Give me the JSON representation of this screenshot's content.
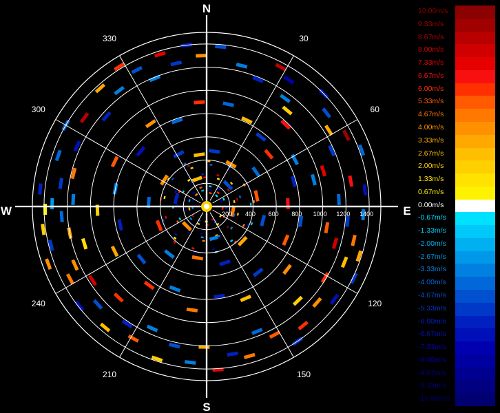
{
  "chart_data": {
    "type": "polar-radar-ppi",
    "compass": {
      "north": "N",
      "east": "E",
      "south": "S",
      "west": "W"
    },
    "azimuth_labels": [
      "30",
      "60",
      "120",
      "150",
      "210",
      "240",
      "300",
      "330"
    ],
    "range_labels": [
      "200",
      "400",
      "600",
      "800",
      "1000",
      "1200",
      "1400"
    ],
    "range_max": 1500,
    "colorbar": {
      "labels": [
        "10.00m/s",
        "9.33m/s",
        "8.67m/s",
        "8.00m/s",
        "7.33m/s",
        "6.67m/s",
        "6.00m/s",
        "5.33m/s",
        "4.67m/s",
        "4.00m/s",
        "3.33m/s",
        "2.67m/s",
        "2.00m/s",
        "1.33m/s",
        "0.67m/s",
        "0.00m/s",
        "-0.67m/s",
        "-1.33m/s",
        "-2.00m/s",
        "-2.67m/s",
        "-3.33m/s",
        "-4.00m/s",
        "-4.67m/s",
        "-5.33m/s",
        "-6.00m/s",
        "-6.67m/s",
        "-7.33m/s",
        "-8.00m/s",
        "-8.67m/s",
        "-9.33m/s",
        "-10.00m/s"
      ],
      "colors": [
        "#8b0000",
        "#a00000",
        "#b80000",
        "#d00000",
        "#e60000",
        "#f81010",
        "#ff3000",
        "#ff5a00",
        "#ff7800",
        "#ff9000",
        "#ffa800",
        "#ffbe00",
        "#ffd000",
        "#ffe200",
        "#fff200",
        "#ffffff",
        "#00e0ff",
        "#00c8f8",
        "#00b0f0",
        "#0098e8",
        "#0080e0",
        "#0068d8",
        "#0050d0",
        "#0038c8",
        "#0020c0",
        "#0010b8",
        "#0000b0",
        "#0000a0",
        "#000090",
        "#000080",
        "#000070"
      ]
    },
    "gates": [
      {
        "az": 5,
        "r": 1380,
        "v": -4.5
      },
      {
        "az": 14,
        "r": 1250,
        "v": -3.2
      },
      {
        "az": 22,
        "r": 1180,
        "v": -6.1
      },
      {
        "az": 28,
        "r": 1360,
        "v": 8.7
      },
      {
        "az": 33,
        "r": 1300,
        "v": -7.4
      },
      {
        "az": 36,
        "r": 1150,
        "v": -3.0
      },
      {
        "az": 40,
        "r": 1080,
        "v": 2.2
      },
      {
        "az": 44,
        "r": 980,
        "v": 6.7
      },
      {
        "az": 46,
        "r": 1400,
        "v": -6.0
      },
      {
        "az": 52,
        "r": 1310,
        "v": -4.4
      },
      {
        "az": 58,
        "r": 1240,
        "v": 3.4
      },
      {
        "az": 63,
        "r": 1350,
        "v": 9.5
      },
      {
        "az": 66,
        "r": 1180,
        "v": -5.5
      },
      {
        "az": 70,
        "r": 1420,
        "v": -4.1
      },
      {
        "az": 73,
        "r": 1050,
        "v": 7.6
      },
      {
        "az": 76,
        "r": 950,
        "v": -3.4
      },
      {
        "az": 80,
        "r": 1260,
        "v": 6.4
      },
      {
        "az": 84,
        "r": 1370,
        "v": -6.6
      },
      {
        "az": 87,
        "r": 1140,
        "v": -4.0
      },
      {
        "az": 93,
        "r": 1350,
        "v": -3.4
      },
      {
        "az": 96,
        "r": 1220,
        "v": -5.0
      },
      {
        "az": 100,
        "r": 1050,
        "v": 5.5
      },
      {
        "az": 103,
        "r": 1300,
        "v": 4.6
      },
      {
        "az": 106,
        "r": 1150,
        "v": 8.0
      },
      {
        "az": 108,
        "r": 1380,
        "v": 3.4
      },
      {
        "az": 112,
        "r": 1280,
        "v": 2.7
      },
      {
        "az": 116,
        "r": 1410,
        "v": -5.6
      },
      {
        "az": 121,
        "r": 1190,
        "v": 6.0
      },
      {
        "az": 126,
        "r": 1360,
        "v": -6.7
      },
      {
        "az": 131,
        "r": 1260,
        "v": 4.0
      },
      {
        "az": 136,
        "r": 1130,
        "v": 2.0
      },
      {
        "az": 141,
        "r": 1320,
        "v": 6.0
      },
      {
        "az": 146,
        "r": 1400,
        "v": -5.3
      },
      {
        "az": 152,
        "r": 1250,
        "v": 5.3
      },
      {
        "az": 158,
        "r": 1160,
        "v": -4.0
      },
      {
        "az": 164,
        "r": 1340,
        "v": 4.7
      },
      {
        "az": 170,
        "r": 1290,
        "v": -6.0
      },
      {
        "az": 176,
        "r": 1410,
        "v": 7.3
      },
      {
        "az": 181,
        "r": 1210,
        "v": 3.5
      },
      {
        "az": 186,
        "r": 1350,
        "v": -3.0
      },
      {
        "az": 193,
        "r": 1230,
        "v": -4.5
      },
      {
        "az": 198,
        "r": 1380,
        "v": 2.2
      },
      {
        "az": 204,
        "r": 1150,
        "v": -3.1
      },
      {
        "az": 209,
        "r": 1300,
        "v": 5.5
      },
      {
        "az": 214,
        "r": 1220,
        "v": -6.1
      },
      {
        "az": 220,
        "r": 1360,
        "v": 2.6
      },
      {
        "az": 224,
        "r": 1090,
        "v": 6.0
      },
      {
        "az": 228,
        "r": 1260,
        "v": -4.4
      },
      {
        "az": 232,
        "r": 1390,
        "v": -6.7
      },
      {
        "az": 237,
        "r": 1170,
        "v": 7.9
      },
      {
        "az": 242,
        "r": 1330,
        "v": 5.0
      },
      {
        "az": 246,
        "r": 1240,
        "v": 3.7
      },
      {
        "az": 250,
        "r": 1450,
        "v": 4.0
      },
      {
        "az": 253,
        "r": 1100,
        "v": 1.5
      },
      {
        "az": 256,
        "r": 1380,
        "v": -5.0
      },
      {
        "az": 259,
        "r": 1200,
        "v": 3.2
      },
      {
        "az": 262,
        "r": 1420,
        "v": 2.0
      },
      {
        "az": 266,
        "r": 1250,
        "v": -3.8
      },
      {
        "az": 269,
        "r": 1390,
        "v": 0.9
      },
      {
        "az": 271,
        "r": 1330,
        "v": -2.4
      },
      {
        "az": 273,
        "r": 1150,
        "v": -3.4
      },
      {
        "az": 276,
        "r": 1440,
        "v": -6.0
      },
      {
        "az": 279,
        "r": 1270,
        "v": -5.4
      },
      {
        "az": 284,
        "r": 1180,
        "v": 4.7
      },
      {
        "az": 289,
        "r": 1350,
        "v": -4.2
      },
      {
        "az": 295,
        "r": 1230,
        "v": -6.6
      },
      {
        "az": 300,
        "r": 1400,
        "v": -3.7
      },
      {
        "az": 306,
        "r": 1300,
        "v": 8.5
      },
      {
        "az": 312,
        "r": 1160,
        "v": -6.2
      },
      {
        "az": 318,
        "r": 1370,
        "v": 3.3
      },
      {
        "az": 323,
        "r": 1250,
        "v": -3.0
      },
      {
        "az": 328,
        "r": 1420,
        "v": 6.3
      },
      {
        "az": 333,
        "r": 1320,
        "v": -4.6
      },
      {
        "az": 338,
        "r": 1190,
        "v": -3.3
      },
      {
        "az": 343,
        "r": 1370,
        "v": 7.2
      },
      {
        "az": 348,
        "r": 1260,
        "v": -5.4
      },
      {
        "az": 353,
        "r": 1400,
        "v": -6.0
      },
      {
        "az": 358,
        "r": 1300,
        "v": 4.0
      },
      {
        "az": 12,
        "r": 900,
        "v": -4.0
      },
      {
        "az": 25,
        "r": 820,
        "v": 3.0
      },
      {
        "az": 38,
        "r": 760,
        "v": -5.5
      },
      {
        "az": 50,
        "r": 700,
        "v": 6.0
      },
      {
        "az": 62,
        "r": 860,
        "v": -3.5
      },
      {
        "az": 74,
        "r": 780,
        "v": -6.0
      },
      {
        "az": 88,
        "r": 700,
        "v": 6.5
      },
      {
        "az": 99,
        "r": 820,
        "v": -4.8
      },
      {
        "az": 113,
        "r": 740,
        "v": 5.2
      },
      {
        "az": 128,
        "r": 880,
        "v": 3.8
      },
      {
        "az": 142,
        "r": 720,
        "v": -5.6
      },
      {
        "az": 157,
        "r": 860,
        "v": 2.8
      },
      {
        "az": 172,
        "r": 780,
        "v": -6.2
      },
      {
        "az": 188,
        "r": 900,
        "v": 4.4
      },
      {
        "az": 201,
        "r": 760,
        "v": -3.6
      },
      {
        "az": 216,
        "r": 840,
        "v": 5.8
      },
      {
        "az": 231,
        "r": 720,
        "v": -4.9
      },
      {
        "az": 244,
        "r": 880,
        "v": 3.1
      },
      {
        "az": 258,
        "r": 760,
        "v": -5.7
      },
      {
        "az": 268,
        "r": 940,
        "v": 1.8
      },
      {
        "az": 281,
        "r": 800,
        "v": -3.3
      },
      {
        "az": 296,
        "r": 880,
        "v": 5.4
      },
      {
        "az": 310,
        "r": 740,
        "v": -6.4
      },
      {
        "az": 326,
        "r": 860,
        "v": 3.9
      },
      {
        "az": 341,
        "r": 780,
        "v": -4.3
      },
      {
        "az": 356,
        "r": 900,
        "v": 6.1
      },
      {
        "az": 8,
        "r": 480,
        "v": -5.0
      },
      {
        "az": 30,
        "r": 420,
        "v": 4.2
      },
      {
        "az": 55,
        "r": 520,
        "v": -3.8
      },
      {
        "az": 78,
        "r": 440,
        "v": 5.1
      },
      {
        "az": 104,
        "r": 500,
        "v": -4.6
      },
      {
        "az": 134,
        "r": 430,
        "v": 3.4
      },
      {
        "az": 162,
        "r": 510,
        "v": -6.0
      },
      {
        "az": 190,
        "r": 450,
        "v": 4.8
      },
      {
        "az": 218,
        "r": 520,
        "v": -3.2
      },
      {
        "az": 248,
        "r": 440,
        "v": 6.3
      },
      {
        "az": 274,
        "r": 500,
        "v": -4.1
      },
      {
        "az": 302,
        "r": 430,
        "v": 3.7
      },
      {
        "az": 332,
        "r": 510,
        "v": -5.3
      },
      {
        "az": 352,
        "r": 450,
        "v": 2.4
      },
      {
        "az": 45,
        "r": 260,
        "v": -4.4
      },
      {
        "az": 100,
        "r": 230,
        "v": 5.0
      },
      {
        "az": 165,
        "r": 280,
        "v": -3.5
      },
      {
        "az": 225,
        "r": 240,
        "v": 4.1
      },
      {
        "az": 285,
        "r": 270,
        "v": -5.8
      },
      {
        "az": 340,
        "r": 250,
        "v": 3.0
      }
    ]
  }
}
